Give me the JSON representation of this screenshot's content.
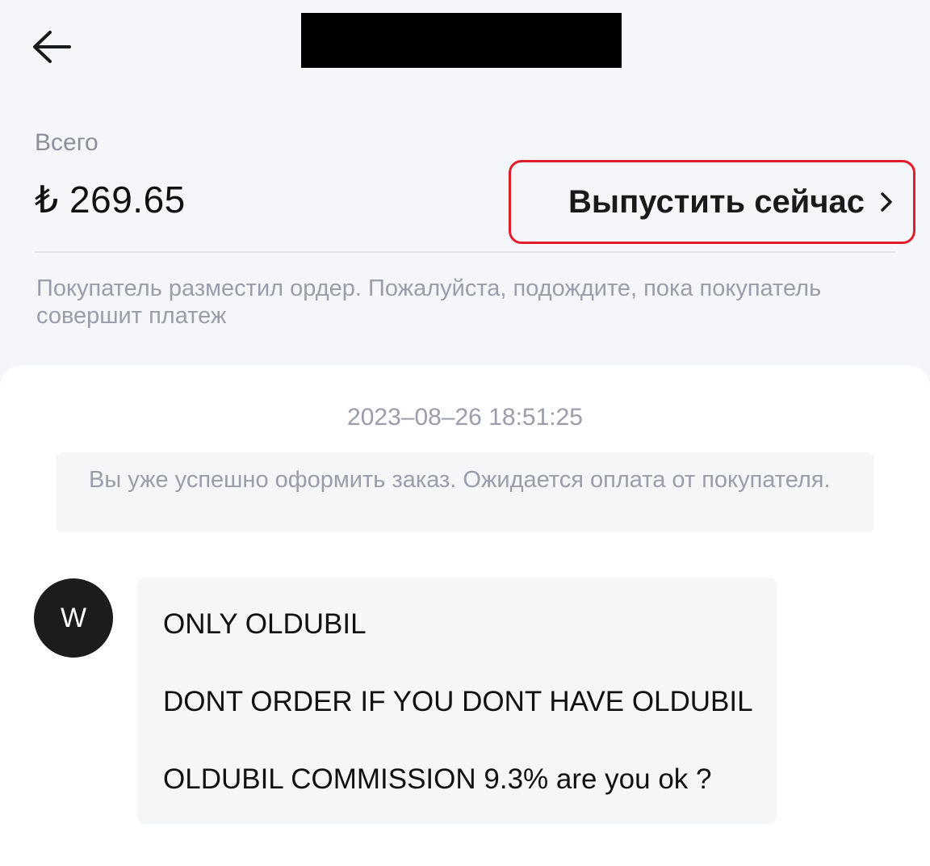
{
  "header": {
    "back_icon": "arrow-left-icon",
    "title_redacted": true
  },
  "summary": {
    "total_label": "Всего",
    "total_amount": "₺ 269.65",
    "release_button_label": "Выпустить сейчас",
    "release_chevron": "›",
    "release_highlight_color": "#e11d2a"
  },
  "status": {
    "text": "Покупатель разместил ордер. Пожалуйста, подождите, пока покупатель совершит платеж"
  },
  "chat": {
    "timestamp": "2023–08–26 18:51:25",
    "system_notice": "Вы уже успешно оформить заказ. Ожидается оплата от покупателя.",
    "messages": [
      {
        "avatar_letter": "W",
        "lines": [
          "ONLY OLDUBIL",
          "DONT ORDER IF YOU DONT HAVE OLDUBIL",
          "OLDUBIL COMMISSION 9.3% are you ok ?"
        ]
      }
    ]
  }
}
